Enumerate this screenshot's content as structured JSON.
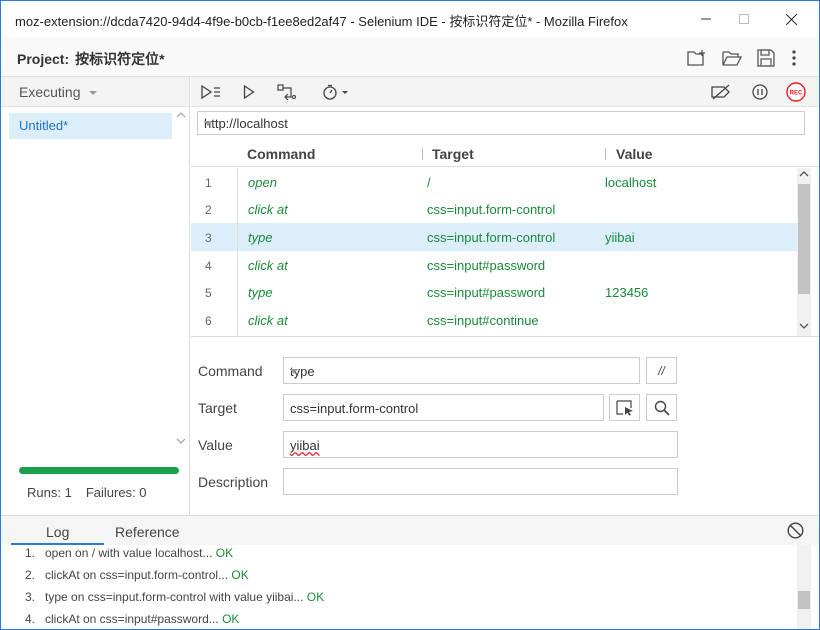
{
  "window": {
    "title": "moz-extension://dcda7420-94d4-4f9e-b0cb-f1ee8ed2af47 - Selenium IDE - 按标识符定位* - Mozilla Firefox"
  },
  "project": {
    "label": "Project:",
    "name": "按标识符定位*"
  },
  "sidebar": {
    "mode": "Executing",
    "suite": "Untitled*",
    "progress": 1.0,
    "runs_label": "Runs: 1",
    "failures_label": "Failures: 0"
  },
  "base_url": "http://localhost",
  "table": {
    "headers": [
      "Command",
      "Target",
      "Value"
    ],
    "rows": [
      {
        "num": "1",
        "command": "open",
        "target": "/",
        "value": "localhost"
      },
      {
        "num": "2",
        "command": "click at",
        "target": "css=input.form-control",
        "value": ""
      },
      {
        "num": "3",
        "command": "type",
        "target": "css=input.form-control",
        "value": "yiibai"
      },
      {
        "num": "4",
        "command": "click at",
        "target": "css=input#password",
        "value": ""
      },
      {
        "num": "5",
        "command": "type",
        "target": "css=input#password",
        "value": "123456"
      },
      {
        "num": "6",
        "command": "click at",
        "target": "css=input#continue",
        "value": ""
      }
    ],
    "selected_row": 3
  },
  "editor": {
    "command_label": "Command",
    "command_value": "type",
    "comment_button": "//",
    "target_label": "Target",
    "target_value": "css=input.form-control",
    "value_label": "Value",
    "value_value": "yiibai",
    "description_label": "Description",
    "description_value": ""
  },
  "log": {
    "tabs": [
      "Log",
      "Reference"
    ],
    "active_tab": "Log",
    "entries": [
      {
        "n": "1.",
        "text": "open on / with value localhost...",
        "status": "OK"
      },
      {
        "n": "2.",
        "text": "clickAt on css=input.form-control...",
        "status": "OK"
      },
      {
        "n": "3.",
        "text": "type on css=input.form-control with value yiibai...",
        "status": "OK"
      },
      {
        "n": "4.",
        "text": "clickAt on css=input#password...",
        "status": "OK"
      }
    ]
  },
  "colors": {
    "accent": "#2b79d8",
    "command_text": "#1a8a3a",
    "selection": "#ddeefb",
    "progress": "#1aa04b",
    "record": "#e0201e"
  }
}
